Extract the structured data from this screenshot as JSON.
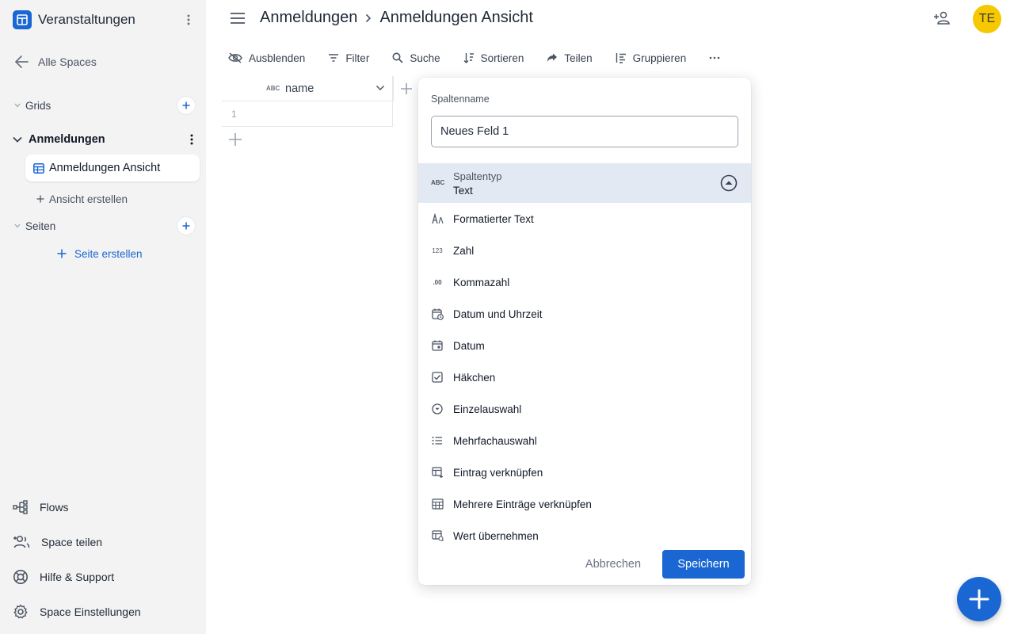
{
  "app": {
    "title": "Veranstaltungen",
    "accent": "#1a66d2"
  },
  "sidebar": {
    "back_label": "Alle Spaces",
    "grids_label": "Grids",
    "grid_item_label": "Anmeldungen",
    "view_item_label": "Anmeldungen Ansicht",
    "create_view_label": "Ansicht erstellen",
    "pages_label": "Seiten",
    "create_page_label": "Seite erstellen",
    "footer": [
      {
        "label": "Flows",
        "icon": "flows-icon"
      },
      {
        "label": "Space teilen",
        "icon": "share-space-icon"
      },
      {
        "label": "Hilfe & Support",
        "icon": "help-icon"
      },
      {
        "label": "Space Einstellungen",
        "icon": "settings-icon"
      }
    ]
  },
  "header": {
    "breadcrumb": [
      "Anmeldungen",
      "Anmeldungen Ansicht"
    ],
    "avatar_initials": "TE",
    "avatar_color": "#f5c800"
  },
  "toolbar": {
    "items": [
      {
        "label": "Ausblenden",
        "icon": "hide-icon"
      },
      {
        "label": "Filter",
        "icon": "filter-icon"
      },
      {
        "label": "Suche",
        "icon": "search-icon"
      },
      {
        "label": "Sortieren",
        "icon": "sort-icon"
      },
      {
        "label": "Teilen",
        "icon": "share-icon"
      },
      {
        "label": "Gruppieren",
        "icon": "group-icon"
      }
    ]
  },
  "grid": {
    "column_type": "ABC",
    "column_name": "name",
    "row_number": "1"
  },
  "dialog": {
    "name_label": "Spaltenname",
    "name_value": "Neues Feld 1",
    "type_caption": "Spaltentyp",
    "type_value": "Text",
    "type_icon_text": "ABC",
    "options": [
      {
        "label": "Formatierter Text",
        "icon": "rich-text-icon"
      },
      {
        "label": "Zahl",
        "icon": "number-icon"
      },
      {
        "label": "Kommazahl",
        "icon": "decimal-icon"
      },
      {
        "label": "Datum und Uhrzeit",
        "icon": "datetime-icon"
      },
      {
        "label": "Datum",
        "icon": "date-icon"
      },
      {
        "label": "Häkchen",
        "icon": "checkbox-icon"
      },
      {
        "label": "Einzelauswahl",
        "icon": "single-select-icon"
      },
      {
        "label": "Mehrfachauswahl",
        "icon": "multi-select-icon"
      },
      {
        "label": "Eintrag verknüpfen",
        "icon": "link-record-icon"
      },
      {
        "label": "Mehrere Einträge verknüpfen",
        "icon": "link-records-icon"
      },
      {
        "label": "Wert übernehmen",
        "icon": "lookup-icon"
      }
    ],
    "cancel_label": "Abbrechen",
    "save_label": "Speichern"
  }
}
